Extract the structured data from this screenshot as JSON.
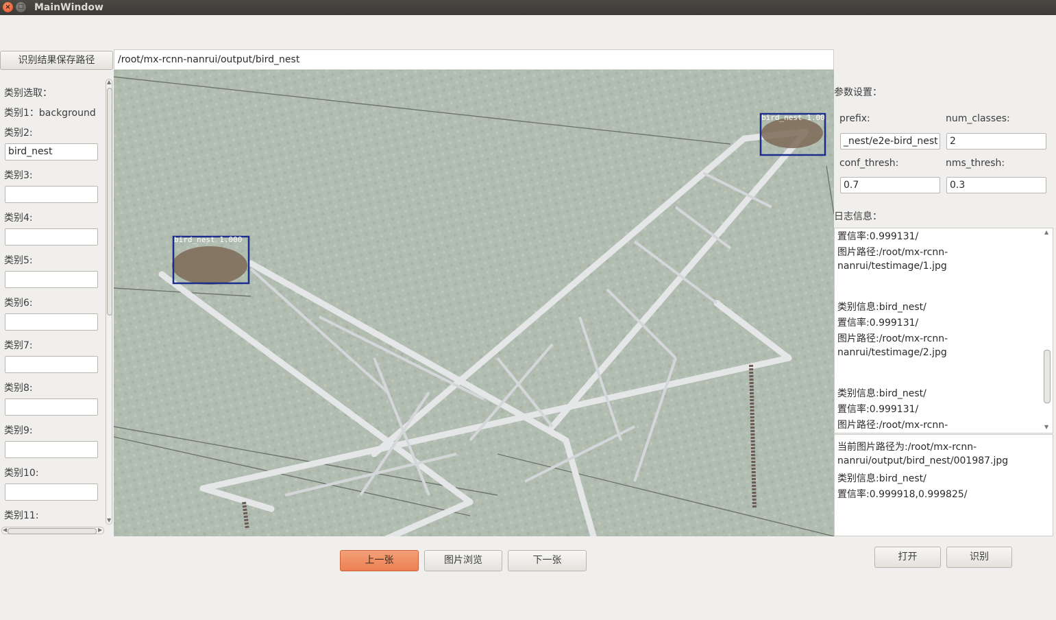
{
  "window": {
    "title": "MainWindow"
  },
  "toolbar": {
    "save_path_button": "识别结果保存路径",
    "save_path_value": "/root/mx-rcnn-nanrui/output/bird_nest"
  },
  "classes": {
    "header": "类别选取：",
    "items": [
      {
        "label": "类别1：background",
        "value": null
      },
      {
        "label": "类别2:",
        "value": "bird_nest"
      },
      {
        "label": "类别3:",
        "value": ""
      },
      {
        "label": "类别4:",
        "value": ""
      },
      {
        "label": "类别5:",
        "value": ""
      },
      {
        "label": "类别6:",
        "value": ""
      },
      {
        "label": "类别7:",
        "value": ""
      },
      {
        "label": "类别8:",
        "value": ""
      },
      {
        "label": "类别9:",
        "value": ""
      },
      {
        "label": "类别10:",
        "value": ""
      },
      {
        "label": "类别11:",
        "value": ""
      }
    ]
  },
  "image": {
    "detections": [
      {
        "label": "bird_nest 1.000"
      },
      {
        "label": "bird_nest 1.00"
      }
    ],
    "box_color": "#1a2d8c"
  },
  "nav": {
    "prev": "上一张",
    "browse": "图片浏览",
    "next": "下一张"
  },
  "params": {
    "header": "参数设置：",
    "prefix_label": "prefix:",
    "prefix_value": "_nest/e2e-bird_nest",
    "num_classes_label": "num_classes:",
    "num_classes_value": "2",
    "conf_thresh_label": "conf_thresh:",
    "conf_thresh_value": "0.7",
    "nms_thresh_label": "nms_thresh:",
    "nms_thresh_value": "0.3"
  },
  "log": {
    "header": "日志信息：",
    "lines": [
      "置信率:0.999131/",
      "图片路径:/root/mx-rcnn-",
      "nanrui/testimage/1.jpg",
      "",
      "类别信息:bird_nest/",
      "置信率:0.999131/",
      "图片路径:/root/mx-rcnn-",
      "nanrui/testimage/2.jpg",
      "",
      "类别信息:bird_nest/",
      "置信率:0.999131/",
      "图片路径:/root/mx-rcnn-"
    ]
  },
  "current": {
    "lines": [
      "当前图片路径为:/root/mx-rcnn-",
      "nanrui/output/bird_nest/001987.jpg",
      "类别信息:bird_nest/",
      "置信率:0.999918,0.999825/"
    ]
  },
  "actions": {
    "open": "打开",
    "recognize": "识别"
  }
}
